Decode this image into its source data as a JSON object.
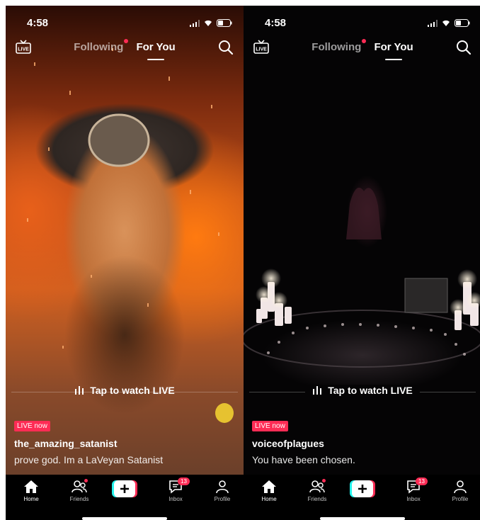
{
  "left": {
    "time": "4:58",
    "tabs": {
      "following": "Following",
      "for_you": "For You"
    },
    "tap_to_watch": "Tap to watch LIVE",
    "live_badge": "LIVE now",
    "username": "the_amazing_satanist",
    "caption": "prove god. Im a LaVeyan Satanist",
    "nav": {
      "home": "Home",
      "friends": "Friends",
      "inbox": "Inbox",
      "profile": "Profile",
      "inbox_count": "13"
    },
    "live_icon_text": "LIVE"
  },
  "right": {
    "time": "4:58",
    "tabs": {
      "following": "Following",
      "for_you": "For You"
    },
    "tap_to_watch": "Tap to watch LIVE",
    "live_badge": "LIVE now",
    "username": "voiceofplagues",
    "caption": "You have been chosen.",
    "nav": {
      "home": "Home",
      "friends": "Friends",
      "inbox": "Inbox",
      "profile": "Profile",
      "inbox_count": "13"
    },
    "live_icon_text": "LIVE"
  },
  "colors": {
    "accent": "#fe2c55",
    "plus_cyan": "#25f4ee",
    "background": "#000000"
  }
}
